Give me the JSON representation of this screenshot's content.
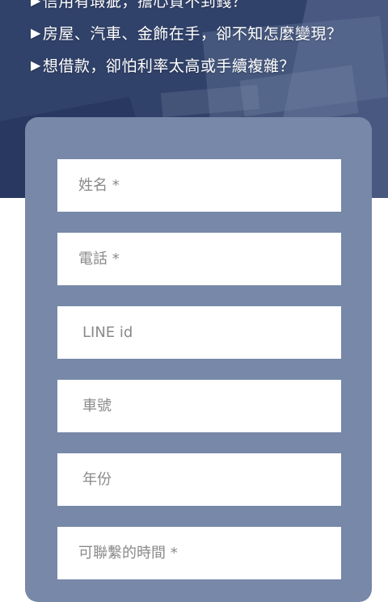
{
  "hero": {
    "bullets": [
      "信用有瑕疵，擔心貸不到錢？",
      "房屋、汽車、金飾在手，卻不知怎麼變現？",
      "想借款，卻怕利率太高或手續複雜？"
    ],
    "bullet_marker": "▶"
  },
  "form": {
    "fields": [
      {
        "name": "name",
        "placeholder": "姓名 *"
      },
      {
        "name": "phone",
        "placeholder": "電話 *"
      },
      {
        "name": "line-id",
        "placeholder": "LINE id"
      },
      {
        "name": "car-plate",
        "placeholder": "車號"
      },
      {
        "name": "year",
        "placeholder": "年份"
      },
      {
        "name": "contact-time",
        "placeholder": "可聯繫的時間 *"
      }
    ]
  },
  "colors": {
    "hero_background": "#34466d",
    "card_background": "#7788a8",
    "field_background": "#ffffff",
    "placeholder_text": "#8a8a8a"
  }
}
